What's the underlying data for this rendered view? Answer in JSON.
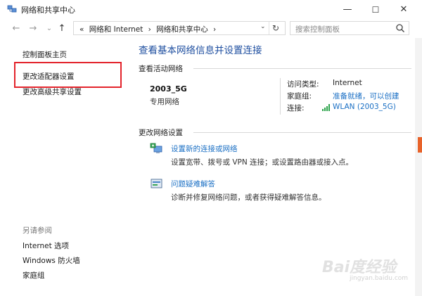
{
  "window": {
    "title": "网络和共享中心",
    "controls": {
      "minimize": "—",
      "maximize": "☐",
      "close": "✕"
    }
  },
  "nav": {
    "back": "←",
    "forward": "→",
    "recent": "⌄",
    "up": "↑"
  },
  "address": {
    "crumbs": [
      "«",
      "网络和 Internet",
      "›",
      "网络和共享中心",
      "›"
    ],
    "dropdown": "⌄",
    "refresh": "↻"
  },
  "search": {
    "placeholder": "搜索控制面板"
  },
  "left": {
    "home": "控制面板主页",
    "adapter": "更改适配器设置",
    "sharing": "更改高级共享设置",
    "see_also": "另请参阅",
    "links": [
      "Internet 选项",
      "Windows 防火墙",
      "家庭组"
    ]
  },
  "main": {
    "title": "查看基本网络信息并设置连接",
    "active_label": "查看活动网络",
    "network": {
      "name": "2003_5G",
      "type": "专用网络"
    },
    "info": {
      "access_key": "访问类型:",
      "access_val": "Internet",
      "homegroup_key": "家庭组:",
      "homegroup_val": "准备就绪，可以创建",
      "conn_key": "连接:",
      "conn_val": "WLAN (2003_5G)"
    },
    "change_label": "更改网络设置",
    "tasks": [
      {
        "link": "设置新的连接或网络",
        "desc": "设置宽带、拨号或 VPN 连接；或设置路由器或接入点。"
      },
      {
        "link": "问题疑难解答",
        "desc": "诊断并修复网络问题，或者获得疑难解答信息。"
      }
    ]
  },
  "watermark": {
    "main": "Bai度经验",
    "sub": "jingyan.baidu.com"
  },
  "colors": {
    "accent": "#1a6fc4",
    "title": "#1f4fa0",
    "highlight": "#e3232b"
  }
}
